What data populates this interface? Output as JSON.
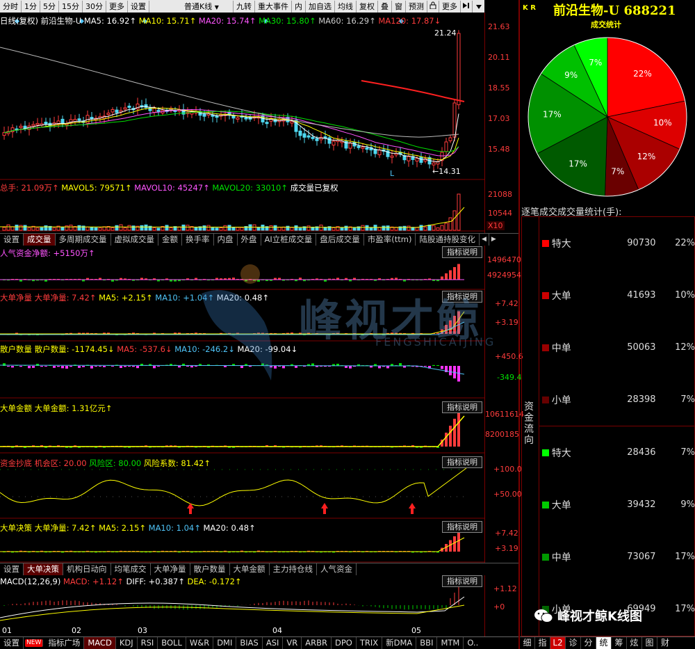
{
  "toolbar": {
    "left": [
      "分时",
      "1分",
      "5分",
      "15分",
      "30分",
      "更多",
      "设置"
    ],
    "right": [
      "普通K线",
      "九转",
      "重大事件",
      "内",
      "加自选",
      "均线",
      "复权",
      "叠",
      "窗",
      "预测",
      "更多"
    ],
    "kline_type_arrow": "▼"
  },
  "header": {
    "market": "K R",
    "stock_name": "前沿生物-U",
    "stock_code": "688221"
  },
  "kline": {
    "title": "日线(复权)",
    "name": "前沿生物-U",
    "ma": [
      {
        "label": "MA5: 16.92↑",
        "color": "#ffffff"
      },
      {
        "label": "MA10: 15.71↑",
        "color": "#ffff00"
      },
      {
        "label": "MA20: 15.74↑",
        "color": "#ff55ff"
      },
      {
        "label": "MA30: 15.80↑",
        "color": "#00e000"
      },
      {
        "label": "MA60: 16.29↑",
        "color": "#cccccc"
      },
      {
        "label": "MA120: 17.87↓",
        "color": "#ff3c3c"
      }
    ],
    "y_ticks": [
      "21.63",
      "20.11",
      "18.55",
      "17.03",
      "15.48"
    ],
    "high_label": "21.24",
    "low_label": "14.31",
    "low_marker": "L"
  },
  "volume": {
    "title": "总手: 21.09万↑",
    "mavol": [
      {
        "label": "MAVOL5: 79571↑",
        "color": "#ffff00"
      },
      {
        "label": "MAVOL10: 45247↑",
        "color": "#ff55ff"
      },
      {
        "label": "MAVOL20: 33010↑",
        "color": "#00e000"
      }
    ],
    "note": "成交量已复权",
    "y_ticks": [
      "21088",
      "10544",
      "X10"
    ]
  },
  "tabs1": [
    "设置",
    "成交量",
    "多周期成交量",
    "虚拟成交量",
    "金额",
    "换手率",
    "内盘",
    "外盘",
    "AI立桩成交量",
    "盘后成交量",
    "市盈率(ttm)",
    "陆股通持股变化"
  ],
  "tabs1_active": "成交量",
  "scroll": {
    "left": "◀",
    "right": "▶"
  },
  "explain_label": "指标说明",
  "ind1": {
    "title": "人气资金净额: +5150万↑",
    "y_ticks": [
      "1496470",
      "4924954"
    ]
  },
  "ind2": {
    "title": "大单净量",
    "parts": [
      {
        "label": "大单净量: 7.42↑",
        "color": "#ff3c3c"
      },
      {
        "label": "MA5: +2.15↑",
        "color": "#ffff00"
      },
      {
        "label": "MA10: +1.04↑",
        "color": "#4fc3f7"
      },
      {
        "label": "MA20: 0.48↑",
        "color": "#ffffff"
      }
    ],
    "y_ticks": [
      "+7.42",
      "+3.19"
    ]
  },
  "ind3": {
    "title": "散户数量",
    "parts": [
      {
        "label": "散户数量: -1174.45↓",
        "color": "#ffff00"
      },
      {
        "label": "MA5: -537.6↓",
        "color": "#ff3c3c"
      },
      {
        "label": "MA10: -246.2↓",
        "color": "#4fc3f7"
      },
      {
        "label": "MA20: -99.04↓",
        "color": "#ffffff"
      }
    ],
    "y_ticks": [
      "+450.6",
      "-349.4"
    ]
  },
  "ind4": {
    "title": "大单金额",
    "parts": [
      {
        "label": "大单金额: 1.31亿元↑",
        "color": "#ffff00"
      }
    ],
    "y_ticks": [
      "10611614",
      "8200185"
    ]
  },
  "ind5": {
    "title": "资金抄底",
    "parts": [
      {
        "label": "机会区: 20.00",
        "color": "#ff3c3c"
      },
      {
        "label": "风险区: 80.00",
        "color": "#00e000"
      },
      {
        "label": "风险系数: 81.42↑",
        "color": "#ffff00"
      }
    ],
    "y_ticks": [
      "+100.0",
      "+50.00"
    ]
  },
  "ind6": {
    "title": "大单决策",
    "parts": [
      {
        "label": "大单净量: 7.42↑",
        "color": "#ffff00"
      },
      {
        "label": "MA5: 2.15↑",
        "color": "#ffff00"
      },
      {
        "label": "MA10: 1.04↑",
        "color": "#4fc3f7"
      },
      {
        "label": "MA20: 0.48↑",
        "color": "#ffffff"
      }
    ],
    "y_ticks": [
      "+7.42",
      "+3.19"
    ]
  },
  "tabs2": [
    "设置",
    "大单决策",
    "机构日动向",
    "均笔成交",
    "大单净量",
    "散户数量",
    "大单金额",
    "主力持仓线",
    "人气资金"
  ],
  "tabs2_active": "大单决策",
  "macd": {
    "title": "MACD(12,26,9)",
    "parts": [
      {
        "label": "MACD: +1.12↑",
        "color": "#ff3c3c"
      },
      {
        "label": "DIFF: +0.387↑",
        "color": "#ffffff"
      },
      {
        "label": "DEA: -0.172↑",
        "color": "#ffff00"
      }
    ],
    "y_ticks": [
      "+1.12",
      "+0"
    ]
  },
  "months": [
    "01",
    "02",
    "03",
    "04",
    "05"
  ],
  "bottom_tabs": [
    "设置",
    "NEW",
    "指标广场",
    "MACD",
    "KDJ",
    "RSI",
    "BOLL",
    "W&R",
    "DMI",
    "BIAS",
    "ASI",
    "VR",
    "ARBR",
    "DPO",
    "TRIX",
    "新DMA",
    "BBI",
    "MTM",
    "O.."
  ],
  "bottom_active": "MACD",
  "pie": {
    "title": "成交统计",
    "slices": [
      {
        "label": "22%",
        "value": 22,
        "color": "#ff0000"
      },
      {
        "label": "10%",
        "value": 10,
        "color": "#dd0000"
      },
      {
        "label": "12%",
        "value": 12,
        "color": "#aa0000"
      },
      {
        "label": "7%",
        "value": 7,
        "color": "#6a0000"
      },
      {
        "label": "17%",
        "value": 17,
        "color": "#005a00"
      },
      {
        "label": "17%",
        "value": 17,
        "color": "#009000"
      },
      {
        "label": "9%",
        "value": 9,
        "color": "#00c000"
      },
      {
        "label": "7%",
        "value": 7,
        "color": "#00ff00"
      }
    ]
  },
  "flow": {
    "section_title": "逐笔成交成交量统计(手):",
    "side_label": "资金流向",
    "rows": [
      {
        "name": "特大",
        "vol": "90730",
        "pct": "22%",
        "color": "#ff0000"
      },
      {
        "name": "大单",
        "vol": "41693",
        "pct": "10%",
        "color": "#cc0000"
      },
      {
        "name": "中单",
        "vol": "50063",
        "pct": "12%",
        "color": "#990000"
      },
      {
        "name": "小单",
        "vol": "28398",
        "pct": "7%",
        "color": "#660000"
      },
      {
        "name": "特大",
        "vol": "28436",
        "pct": "7%",
        "color": "#00ff00"
      },
      {
        "name": "大单",
        "vol": "39432",
        "pct": "9%",
        "color": "#00cc00"
      },
      {
        "name": "中单",
        "vol": "73067",
        "pct": "17%",
        "color": "#009900"
      },
      {
        "name": "小单",
        "vol": "69949",
        "pct": "17%",
        "color": "#006600"
      }
    ]
  },
  "right_tabs": [
    "细",
    "指",
    "L2",
    "诊",
    "分",
    "统",
    "筹",
    "炫",
    "图",
    "财"
  ],
  "right_active": "L2",
  "right_selected": "统",
  "watermark": {
    "brand": "峰视才鲸K线图",
    "center": "峰视才鲸",
    "center_sub": "FENGSHICAIJING"
  }
}
